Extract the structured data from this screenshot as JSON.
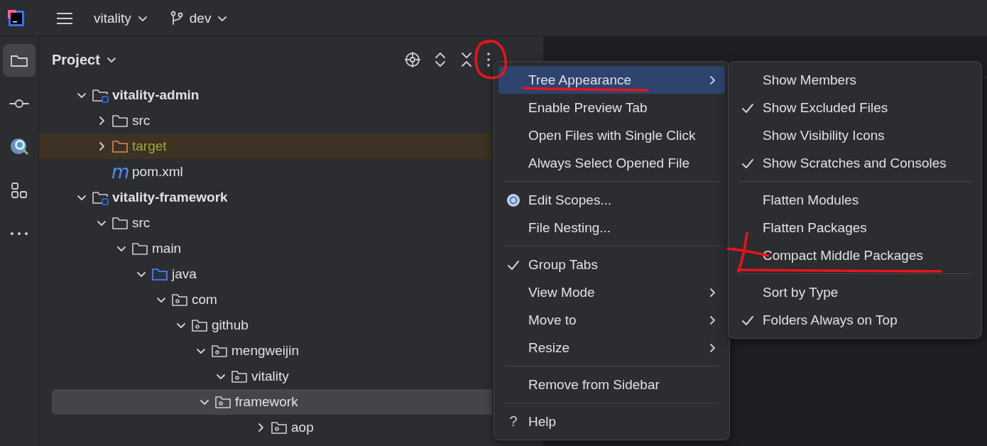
{
  "title_bar": {
    "project": "vitality",
    "branch": "dev"
  },
  "tool_strip": [
    {
      "kind": "folder",
      "selected": true
    },
    {
      "kind": "commit",
      "selected": false
    },
    {
      "kind": "profiler",
      "selected": false
    },
    {
      "kind": "structure",
      "selected": false
    },
    {
      "kind": "more",
      "selected": false
    }
  ],
  "project_panel": {
    "title": "Project",
    "tree": [
      {
        "label": "vitality-admin",
        "kind": "module",
        "expanded": true,
        "selected": false,
        "children": [
          {
            "label": "src",
            "kind": "folder",
            "expanded": false,
            "selected": false
          },
          {
            "label": "target",
            "kind": "excluded",
            "expanded": false,
            "selected": false
          },
          {
            "label": "pom.xml",
            "kind": "maven",
            "icon_text": "m",
            "selected": false
          }
        ]
      },
      {
        "label": "vitality-framework",
        "kind": "module",
        "expanded": true,
        "selected": false,
        "children": [
          {
            "label": "src",
            "kind": "folder",
            "expanded": true,
            "selected": false,
            "children": [
              {
                "label": "main",
                "kind": "folder",
                "expanded": true,
                "selected": false,
                "children": [
                  {
                    "label": "java",
                    "kind": "source",
                    "expanded": true,
                    "selected": false,
                    "children": [
                      {
                        "label": "com",
                        "kind": "package",
                        "expanded": true,
                        "selected": false,
                        "children": [
                          {
                            "label": "github",
                            "kind": "package",
                            "expanded": true,
                            "selected": false,
                            "children": [
                              {
                                "label": "mengweijin",
                                "kind": "package",
                                "expanded": true,
                                "selected": false,
                                "children": [
                                  {
                                    "label": "vitality",
                                    "kind": "package",
                                    "expanded": true,
                                    "selected": false,
                                    "children": [
                                      {
                                        "label": "framework",
                                        "kind": "package",
                                        "expanded": true,
                                        "selected": true,
                                        "children": [
                                          {
                                            "label": "aop",
                                            "kind": "package",
                                            "expanded": false,
                                            "selected": false
                                          }
                                        ]
                                      }
                                    ]
                                  }
                                ]
                              }
                            ]
                          }
                        ]
                      }
                    ]
                  }
                ]
              }
            ]
          }
        ]
      }
    ]
  },
  "menu": [
    {
      "kind": "item",
      "label": "Tree Appearance",
      "submenu": true,
      "selected": true
    },
    {
      "kind": "item",
      "label": "Enable Preview Tab",
      "submenu": false,
      "selected": false
    },
    {
      "kind": "item",
      "label": "Open Files with Single Click",
      "submenu": false,
      "selected": false
    },
    {
      "kind": "item",
      "label": "Always Select Opened File",
      "submenu": false,
      "selected": false
    },
    {
      "kind": "separator"
    },
    {
      "kind": "radio",
      "label": "Edit Scopes...",
      "submenu": false,
      "selected": false
    },
    {
      "kind": "item",
      "label": "File Nesting...",
      "submenu": false,
      "selected": false
    },
    {
      "kind": "separator"
    },
    {
      "kind": "check",
      "label": "Group Tabs",
      "checked": true,
      "submenu": false,
      "selected": false
    },
    {
      "kind": "item",
      "label": "View Mode",
      "submenu": true,
      "selected": false
    },
    {
      "kind": "item",
      "label": "Move to",
      "submenu": true,
      "selected": false
    },
    {
      "kind": "item",
      "label": "Resize",
      "submenu": true,
      "selected": false
    },
    {
      "kind": "separator"
    },
    {
      "kind": "item",
      "label": "Remove from Sidebar",
      "submenu": false,
      "selected": false
    },
    {
      "kind": "separator"
    },
    {
      "kind": "help",
      "icon_text": "?",
      "label": "Help",
      "submenu": false,
      "selected": false
    }
  ],
  "submenu": [
    {
      "kind": "check",
      "label": "Show Members",
      "checked": false
    },
    {
      "kind": "check",
      "label": "Show Excluded Files",
      "checked": true
    },
    {
      "kind": "check",
      "label": "Show Visibility Icons",
      "checked": false
    },
    {
      "kind": "check",
      "label": "Show Scratches and Consoles",
      "checked": true
    },
    {
      "kind": "separator"
    },
    {
      "kind": "check",
      "label": "Flatten Modules",
      "checked": false
    },
    {
      "kind": "check",
      "label": "Flatten Packages",
      "checked": false
    },
    {
      "kind": "check",
      "label": "Compact Middle Packages",
      "checked": false
    },
    {
      "kind": "separator"
    },
    {
      "kind": "check",
      "label": "Sort by Type",
      "checked": false
    },
    {
      "kind": "check",
      "label": "Folders Always on Top",
      "checked": true
    }
  ],
  "annotations": [
    {
      "kind": "circle"
    },
    {
      "kind": "underline"
    },
    {
      "kind": "cross"
    },
    {
      "kind": "underline"
    }
  ]
}
